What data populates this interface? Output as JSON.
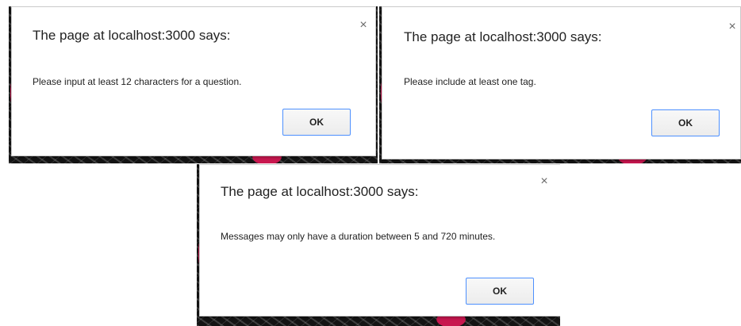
{
  "dialogs": [
    {
      "title": "The page at localhost:3000 says:",
      "message": "Please input at least 12 characters for a question.",
      "close_icon": "×",
      "ok_label": "OK"
    },
    {
      "title": "The page at localhost:3000 says:",
      "message": "Please include at least one tag.",
      "close_icon": "×",
      "ok_label": "OK"
    },
    {
      "title": "The page at localhost:3000 says:",
      "message": "Messages may only have a duration between 5 and 720 minutes.",
      "close_icon": "×",
      "ok_label": "OK"
    }
  ],
  "colors": {
    "button_focus_border": "#4d90fe",
    "background_accent": "#c8174f"
  }
}
